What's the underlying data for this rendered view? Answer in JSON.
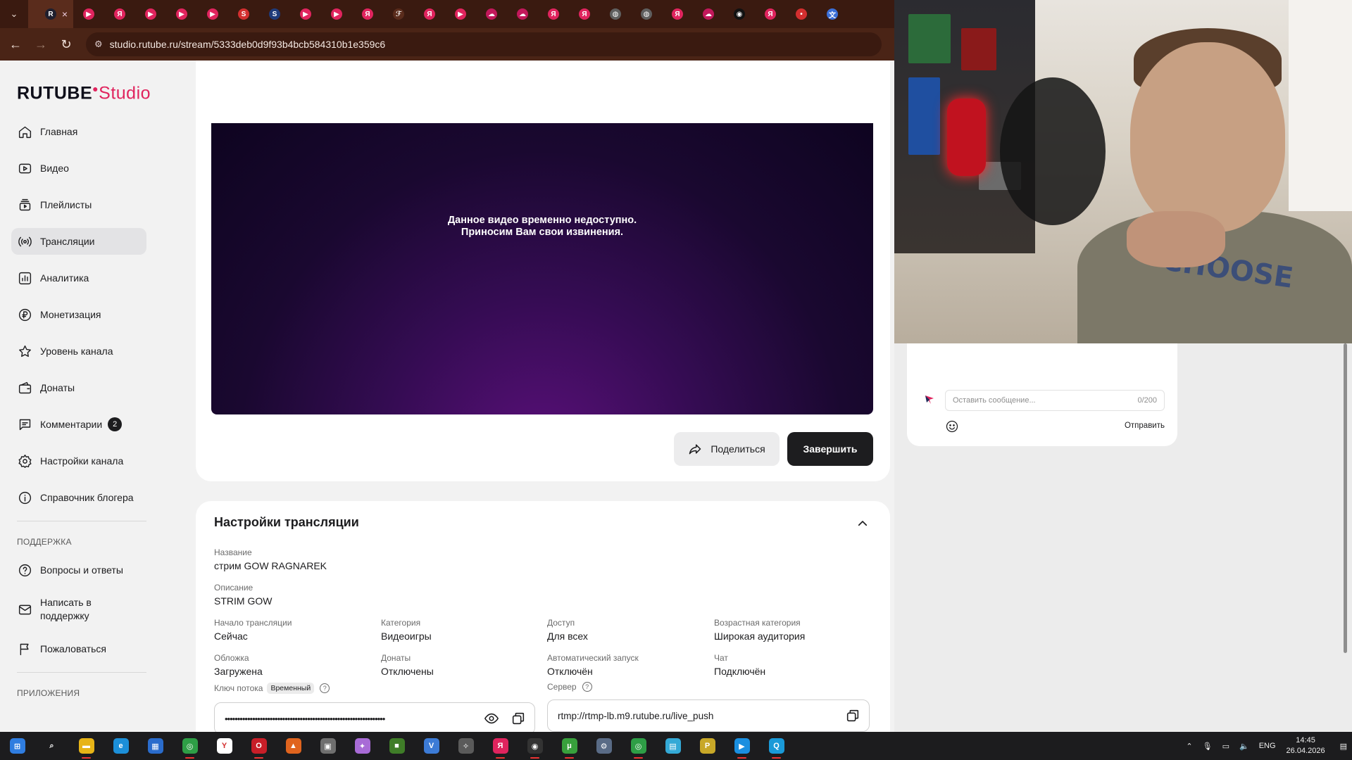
{
  "browser": {
    "url": "studio.rutube.ru/stream/5333deb0d9f93b4bcb584310b1e359c6",
    "tabs": [
      {
        "icon": "rutube-favicon",
        "color": "#1f1f2e",
        "glyph": "R",
        "active": true
      },
      {
        "icon": "rutube-play-favicon",
        "color": "#e0245e",
        "glyph": "▶"
      },
      {
        "icon": "yandex-favicon",
        "color": "#e0245e",
        "glyph": "Я"
      },
      {
        "icon": "rutube-play-favicon",
        "color": "#e0245e",
        "glyph": "▶"
      },
      {
        "icon": "rutube-play-favicon",
        "color": "#e0245e",
        "glyph": "▶"
      },
      {
        "icon": "rutube-play-favicon",
        "color": "#e0245e",
        "glyph": "▶"
      },
      {
        "icon": "s-red-favicon",
        "color": "#d32f2f",
        "glyph": "S"
      },
      {
        "icon": "s-blue-favicon",
        "color": "#1f3b7a",
        "glyph": "S"
      },
      {
        "icon": "rutube-play-favicon",
        "color": "#e0245e",
        "glyph": "▶"
      },
      {
        "icon": "rutube-play-favicon",
        "color": "#e0245e",
        "glyph": "▶"
      },
      {
        "icon": "yandex-favicon",
        "color": "#e0245e",
        "glyph": "Я"
      },
      {
        "icon": "fork-favicon",
        "color": "#5a2c1c",
        "glyph": "ℱ"
      },
      {
        "icon": "yandex-favicon",
        "color": "#e0245e",
        "glyph": "Я"
      },
      {
        "icon": "rutube-play-favicon",
        "color": "#e0245e",
        "glyph": "▶"
      },
      {
        "icon": "cloud-favicon",
        "color": "#c2185b",
        "glyph": "☁"
      },
      {
        "icon": "cloud-favicon",
        "color": "#c2185b",
        "glyph": "☁"
      },
      {
        "icon": "yandex-favicon",
        "color": "#e0245e",
        "glyph": "Я"
      },
      {
        "icon": "yandex-favicon",
        "color": "#e0245e",
        "glyph": "Я"
      },
      {
        "icon": "globe-favicon",
        "color": "#5f5f5f",
        "glyph": "◍"
      },
      {
        "icon": "globe-favicon",
        "color": "#5f5f5f",
        "glyph": "◍"
      },
      {
        "icon": "yandex-favicon",
        "color": "#e0245e",
        "glyph": "Я"
      },
      {
        "icon": "cloud-favicon",
        "color": "#c2185b",
        "glyph": "☁"
      },
      {
        "icon": "dark-favicon",
        "color": "#111111",
        "glyph": "◉"
      },
      {
        "icon": "yandex-favicon",
        "color": "#e0245e",
        "glyph": "Я"
      },
      {
        "icon": "red-dot-favicon",
        "color": "#d32f2f",
        "glyph": "•"
      },
      {
        "icon": "translate-favicon",
        "color": "#3b6fd8",
        "glyph": "文"
      }
    ]
  },
  "app": {
    "logo_main": "RUTUBE",
    "logo_sub": "Studio"
  },
  "sidebar": {
    "items": [
      {
        "label": "Главная",
        "icon": "home-icon"
      },
      {
        "label": "Видео",
        "icon": "video-icon"
      },
      {
        "label": "Плейлисты",
        "icon": "playlist-icon"
      },
      {
        "label": "Трансляции",
        "icon": "broadcast-icon",
        "active": true
      },
      {
        "label": "Аналитика",
        "icon": "analytics-icon"
      },
      {
        "label": "Монетизация",
        "icon": "ruble-icon"
      },
      {
        "label": "Уровень канала",
        "icon": "star-icon"
      },
      {
        "label": "Донаты",
        "icon": "wallet-icon"
      },
      {
        "label": "Комментарии",
        "icon": "comment-icon",
        "badge": "2"
      },
      {
        "label": "Настройки канала",
        "icon": "gear-icon"
      },
      {
        "label": "Справочник блогера",
        "icon": "info-icon"
      }
    ],
    "support_heading": "ПОДДЕРЖКА",
    "support_items": [
      {
        "label": "Вопросы и ответы",
        "icon": "question-icon"
      },
      {
        "label": "Написать в поддержку",
        "icon": "mail-icon"
      },
      {
        "label": "Пожаловаться",
        "icon": "flag-icon"
      }
    ],
    "apps_heading": "ПРИЛОЖЕНИЯ"
  },
  "player": {
    "message_line1": "Данное видео временно недоступно.",
    "message_line2": "Приносим Вам свои извинения.",
    "share_label": "Поделиться",
    "end_label": "Завершить"
  },
  "settings": {
    "title": "Настройки трансляции",
    "name_label": "Название",
    "name_value": "стрим GOW RAGNAREK",
    "desc_label": "Описание",
    "desc_value": "STRIM GOW",
    "grid": [
      {
        "label": "Начало трансляции",
        "value": "Сейчас"
      },
      {
        "label": "Категория",
        "value": "Видеоигры"
      },
      {
        "label": "Доступ",
        "value": "Для всех"
      },
      {
        "label": "Возрастная категория",
        "value": "Широкая аудитория"
      },
      {
        "label": "Обложка",
        "value": "Загружена"
      },
      {
        "label": "Донаты",
        "value": "Отключены"
      },
      {
        "label": "Автоматический запуск",
        "value": "Отключён"
      },
      {
        "label": "Чат",
        "value": "Подключён"
      }
    ],
    "key_label": "Ключ потока",
    "key_tag": "Временный",
    "key_value": "••••••••••••••••••••••••••••••••••••••••••••••••••••••••••••••••",
    "server_label": "Сервер",
    "server_value": "rtmp://rtmp-lb.m9.rutube.ru/live_push"
  },
  "chat": {
    "placeholder": "Оставить сообщение...",
    "counter": "0/200",
    "send_label": "Отправить"
  },
  "webcam": {
    "shirt_print": "CHOOSE"
  },
  "taskbar": {
    "apps": [
      {
        "name": "windows-start-icon",
        "color": "#2f7de0",
        "glyph": "⊞"
      },
      {
        "name": "search-icon",
        "color": "#1c1c1e",
        "glyph": "⌕"
      },
      {
        "name": "file-explorer-icon",
        "color": "#e7b417",
        "glyph": "▬"
      },
      {
        "name": "edge-icon",
        "color": "#1c8fd8",
        "glyph": "e"
      },
      {
        "name": "store-icon",
        "color": "#2a6ccc",
        "glyph": "▦"
      },
      {
        "name": "chrome-icon",
        "color": "#2e9e46",
        "glyph": "◎"
      },
      {
        "name": "yandex-browser-icon",
        "color": "#ffffff",
        "glyph": "Y"
      },
      {
        "name": "opera-icon",
        "color": "#c81e28",
        "glyph": "O"
      },
      {
        "name": "fox-app-icon",
        "color": "#e0641e",
        "glyph": "▲"
      },
      {
        "name": "tanks-app-icon",
        "color": "#6f6f6f",
        "glyph": "▣"
      },
      {
        "name": "game-app-icon",
        "color": "#a86bd6",
        "glyph": "✦"
      },
      {
        "name": "minecraft-icon",
        "color": "#3f7d28",
        "glyph": "■"
      },
      {
        "name": "vpn-icon",
        "color": "#3c7bd6",
        "glyph": "V"
      },
      {
        "name": "star-app-icon",
        "color": "#5a5a5a",
        "glyph": "✧"
      },
      {
        "name": "yandex-icon",
        "color": "#e0245e",
        "glyph": "Я"
      },
      {
        "name": "obs-icon",
        "color": "#333333",
        "glyph": "◉"
      },
      {
        "name": "utorrent-icon",
        "color": "#38a03c",
        "glyph": "μ"
      },
      {
        "name": "steam-settings-icon",
        "color": "#596b86",
        "glyph": "⚙"
      },
      {
        "name": "chrome-alt-icon",
        "color": "#2e9e46",
        "glyph": "◎"
      },
      {
        "name": "notepad-icon",
        "color": "#34a9d6",
        "glyph": "▤"
      },
      {
        "name": "pcoin-icon",
        "color": "#c8a828",
        "glyph": "P"
      },
      {
        "name": "media-player-icon",
        "color": "#1a8fe0",
        "glyph": "▶"
      },
      {
        "name": "qbit-icon",
        "color": "#1a9ad8",
        "glyph": "Q"
      }
    ],
    "lang": "ENG",
    "time": "14:45",
    "date": "26.04.2026"
  }
}
